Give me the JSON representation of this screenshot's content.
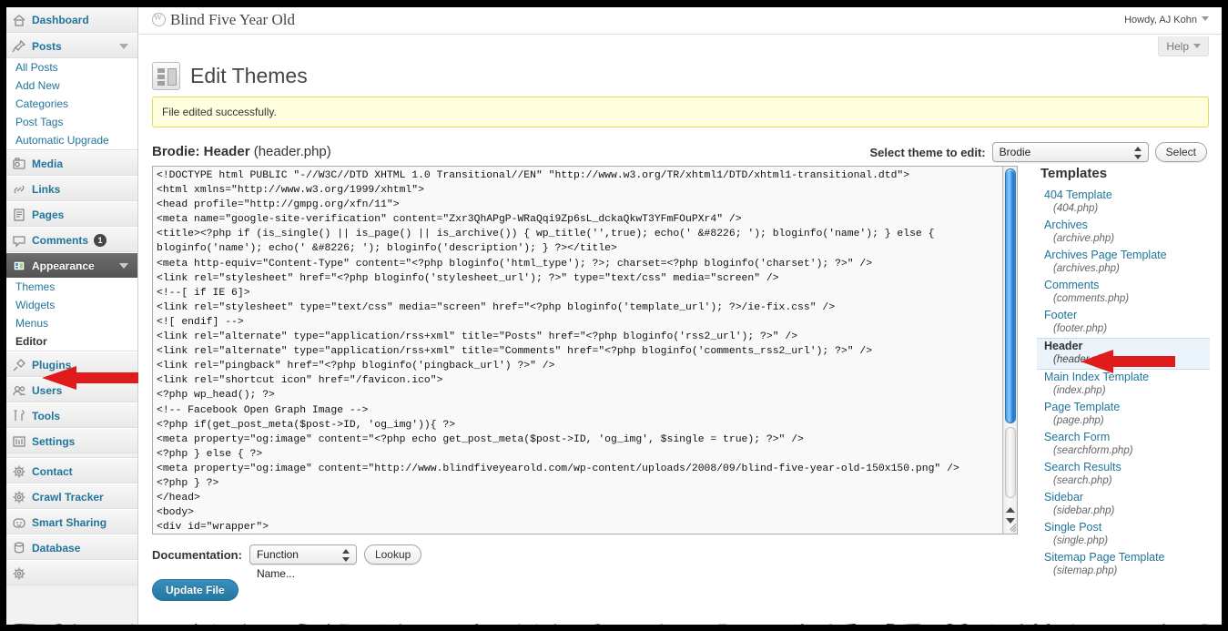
{
  "window": {
    "site_title": "Blind Five Year Old",
    "user_greeting": "Howdy, AJ Kohn",
    "help_label": "Help"
  },
  "page": {
    "title": "Edit Themes",
    "notice": "File edited successfully.",
    "file_theme": "Brodie: Header",
    "file_name": "(header.php)"
  },
  "theme_selector": {
    "label": "Select theme to edit:",
    "selected": "Brodie",
    "button": "Select"
  },
  "documentation": {
    "label": "Documentation:",
    "selected": "Function Name...",
    "button": "Lookup"
  },
  "actions": {
    "update_file": "Update File"
  },
  "editor": {
    "content": "<!DOCTYPE html PUBLIC \"-//W3C//DTD XHTML 1.0 Transitional//EN\" \"http://www.w3.org/TR/xhtml1/DTD/xhtml1-transitional.dtd\">\n<html xmlns=\"http://www.w3.org/1999/xhtml\">\n<head profile=\"http://gmpg.org/xfn/11\">\n<meta name=\"google-site-verification\" content=\"Zxr3QhAPgP-WRaQqi9Zp6sL_dckaQkwT3YFmFOuPXr4\" />\n<title><?php if (is_single() || is_page() || is_archive()) { wp_title('',true); echo(' &#8226; '); bloginfo('name'); } else {\nbloginfo('name'); echo(' &#8226; '); bloginfo('description'); } ?></title>\n<meta http-equiv=\"Content-Type\" content=\"<?php bloginfo('html_type'); ?>; charset=<?php bloginfo('charset'); ?>\" />\n<link rel=\"stylesheet\" href=\"<?php bloginfo('stylesheet_url'); ?>\" type=\"text/css\" media=\"screen\" />\n<!--[ if IE 6]>\n<link rel=\"stylesheet\" type=\"text/css\" media=\"screen\" href=\"<?php bloginfo('template_url'); ?>/ie-fix.css\" />\n<![ endif] -->\n<link rel=\"alternate\" type=\"application/rss+xml\" title=\"Posts\" href=\"<?php bloginfo('rss2_url'); ?>\" />\n<link rel=\"alternate\" type=\"application/rss+xml\" title=\"Comments\" href=\"<?php bloginfo('comments_rss2_url'); ?>\" />\n<link rel=\"pingback\" href=\"<?php bloginfo('pingback_url') ?>\" />\n<link rel=\"shortcut icon\" href=\"/favicon.ico\">\n<?php wp_head(); ?>\n<!-- Facebook Open Graph Image -->\n<?php if(get_post_meta($post->ID, 'og_img')){ ?>\n<meta property=\"og:image\" content=\"<?php echo get_post_meta($post->ID, 'og_img', $single = true); ?>\" />\n<?php } else { ?>\n<meta property=\"og:image\" content=\"http://www.blindfiveyearold.com/wp-content/uploads/2008/09/blind-five-year-old-150x150.png\" />\n<?php } ?>\n</head>\n<body>\n<div id=\"wrapper\">"
  },
  "sidebar": {
    "items": [
      {
        "label": "Dashboard",
        "icon": "dashboard-icon",
        "type": "top",
        "current": false,
        "has_arrow": false
      },
      {
        "label": "Posts",
        "icon": "pin-icon",
        "type": "top",
        "current": false,
        "has_arrow": true
      },
      {
        "label": "All Posts",
        "type": "sub",
        "current": false
      },
      {
        "label": "Add New",
        "type": "sub",
        "current": false
      },
      {
        "label": "Categories",
        "type": "sub",
        "current": false
      },
      {
        "label": "Post Tags",
        "type": "sub",
        "current": false
      },
      {
        "label": "Automatic Upgrade",
        "type": "sub",
        "current": false
      },
      {
        "label": "Media",
        "icon": "media-icon",
        "type": "top",
        "current": false,
        "has_arrow": false
      },
      {
        "label": "Links",
        "icon": "link-icon",
        "type": "top",
        "current": false,
        "has_arrow": false
      },
      {
        "label": "Pages",
        "icon": "pages-icon",
        "type": "top",
        "current": false,
        "has_arrow": false
      },
      {
        "label": "Comments",
        "icon": "comment-icon",
        "type": "top",
        "current": false,
        "has_arrow": false,
        "badge": "1"
      },
      {
        "label": "Appearance",
        "icon": "appearance-icon",
        "type": "top",
        "current": true,
        "has_arrow": true
      },
      {
        "label": "Themes",
        "type": "sub",
        "current": false
      },
      {
        "label": "Widgets",
        "type": "sub",
        "current": false
      },
      {
        "label": "Menus",
        "type": "sub",
        "current": false
      },
      {
        "label": "Editor",
        "type": "sub",
        "current": true
      },
      {
        "label": "Plugins",
        "icon": "plug-icon",
        "type": "top",
        "current": false,
        "has_arrow": false
      },
      {
        "label": "Users",
        "icon": "users-icon",
        "type": "top",
        "current": false,
        "has_arrow": false
      },
      {
        "label": "Tools",
        "icon": "tools-icon",
        "type": "top",
        "current": false,
        "has_arrow": false
      },
      {
        "label": "Settings",
        "icon": "settings-icon",
        "type": "top",
        "current": false,
        "has_arrow": false
      },
      {
        "label": "Contact",
        "icon": "gear-icon",
        "type": "top",
        "current": false,
        "has_arrow": false,
        "separator_before": true
      },
      {
        "label": "Crawl Tracker",
        "icon": "gear-icon",
        "type": "top",
        "current": false,
        "has_arrow": false
      },
      {
        "label": "Smart Sharing",
        "icon": "face-icon",
        "type": "top",
        "current": false,
        "has_arrow": false
      },
      {
        "label": "Database",
        "icon": "db-icon",
        "type": "top",
        "current": false,
        "has_arrow": false
      }
    ]
  },
  "templates": {
    "heading": "Templates",
    "items": [
      {
        "name": "404 Template",
        "file": "(404.php)",
        "current": false
      },
      {
        "name": "Archives",
        "file": "(archive.php)",
        "current": false
      },
      {
        "name": "Archives Page Template",
        "file": "(archives.php)",
        "current": false
      },
      {
        "name": "Comments",
        "file": "(comments.php)",
        "current": false
      },
      {
        "name": "Footer",
        "file": "(footer.php)",
        "current": false
      },
      {
        "name": "Header",
        "file": "(header.php)",
        "current": true
      },
      {
        "name": "Main Index Template",
        "file": "(index.php)",
        "current": false
      },
      {
        "name": "Page Template",
        "file": "(page.php)",
        "current": false
      },
      {
        "name": "Search Form",
        "file": "(searchform.php)",
        "current": false
      },
      {
        "name": "Search Results",
        "file": "(search.php)",
        "current": false
      },
      {
        "name": "Sidebar",
        "file": "(sidebar.php)",
        "current": false
      },
      {
        "name": "Single Post",
        "file": "(single.php)",
        "current": false
      },
      {
        "name": "Sitemap Page Template",
        "file": "(sitemap.php)",
        "current": false
      }
    ]
  },
  "annotations": {
    "arrow_color": "#e01b1b",
    "arrows": [
      {
        "target": "sidebar-item-editor"
      },
      {
        "target": "template-item-header"
      }
    ]
  }
}
